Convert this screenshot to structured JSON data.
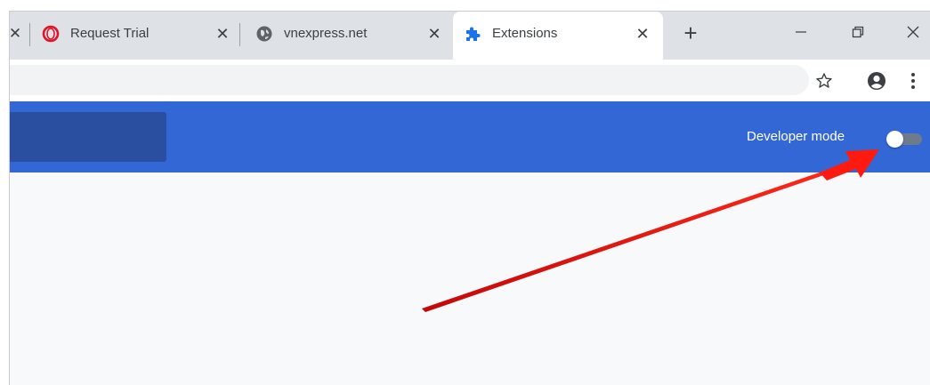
{
  "tabs": [
    {
      "title": "Request Trial",
      "icon": "opera-icon",
      "active": false
    },
    {
      "title": "vnexpress.net",
      "icon": "globe-icon",
      "active": false
    },
    {
      "title": "Extensions",
      "icon": "puzzle-icon",
      "active": true
    }
  ],
  "tab_close_glyph": "✕",
  "new_tab_glyph": "+",
  "header": {
    "developer_mode_label": "Developer mode",
    "developer_mode_enabled": false
  },
  "colors": {
    "header": "#3367d6",
    "search_box": "#2a4fa0",
    "arrow": "#e8120c",
    "opera_red": "#e0142a",
    "extension_blue": "#1a73e8"
  }
}
